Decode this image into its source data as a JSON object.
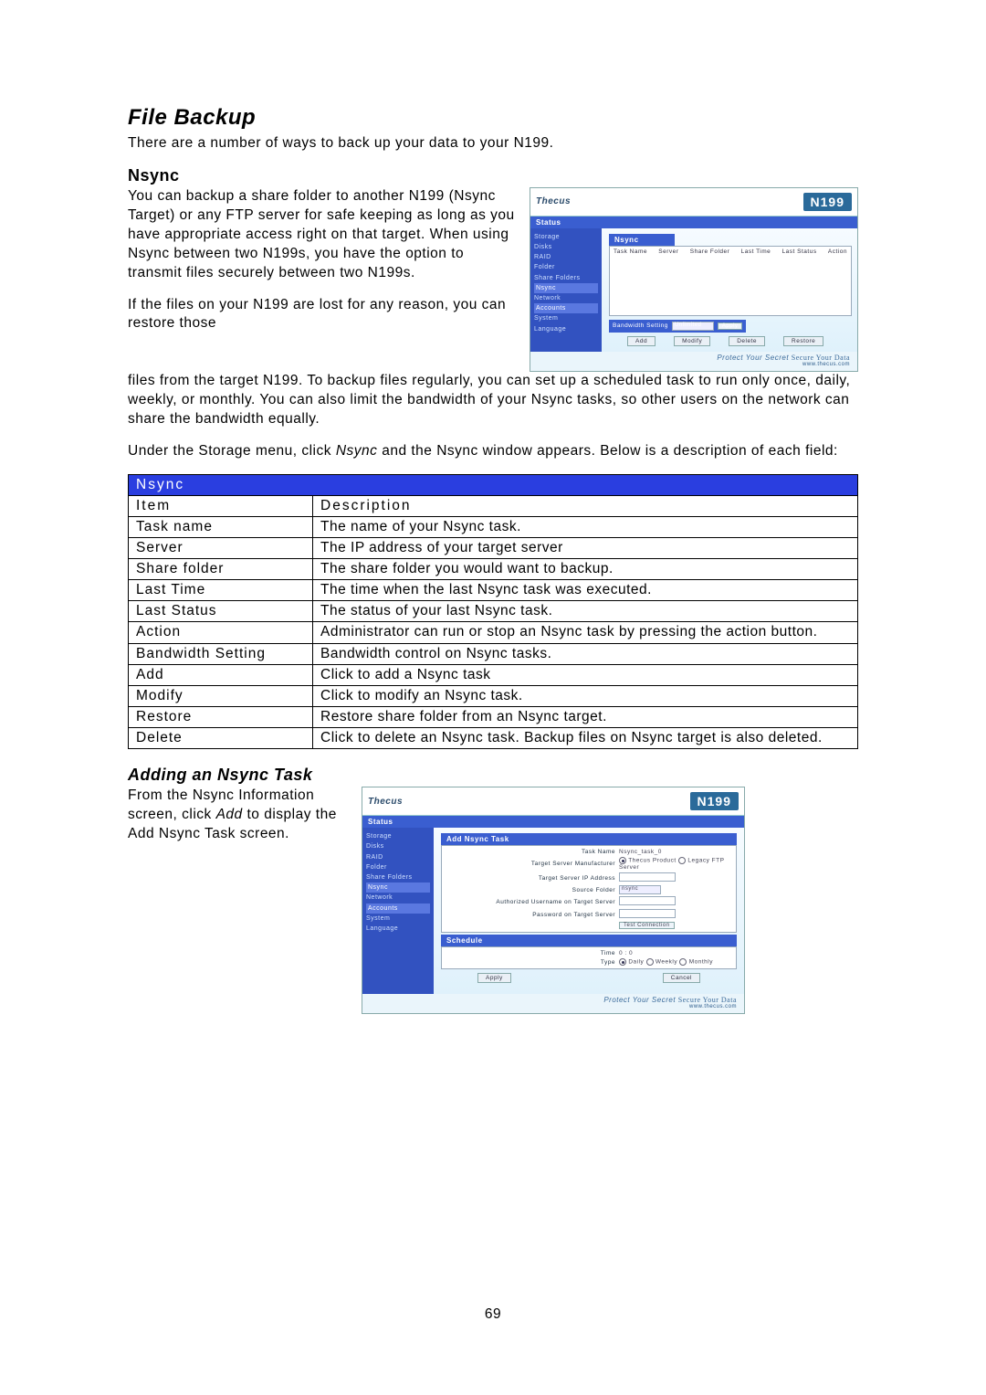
{
  "page_number": "69",
  "h_file_backup": "File Backup",
  "p_file_backup_intro": "There are a number of ways to back up your data to your N199.",
  "h_nsync": "Nsync",
  "nsync_p1": "You can backup a share folder to another N199 (Nsync Target) or any FTP server for safe keeping as long as you have appropriate access right on that target. When using Nsync between two N199s, you have the option to transmit files securely between two N199s.",
  "nsync_p2_a": "If the files on your N199 are lost for any reason, you can restore those",
  "nsync_p2_b": "files from the target N199. To backup files regularly, you can set up a scheduled task to run only once, daily, weekly, or monthly. You can also limit the bandwidth of your Nsync tasks, so other users on the network can share the bandwidth equally.",
  "nsync_p3_pre": "Under the Storage menu, click ",
  "nsync_p3_em": "Nsync",
  "nsync_p3_post": " and the Nsync window appears. Below is a description of each field:",
  "table": {
    "title": "Nsync",
    "head_item": "Item",
    "head_desc": "Description",
    "rows": [
      {
        "item": "Task name",
        "desc": "The name of your Nsync task."
      },
      {
        "item": "Server",
        "desc": "The IP address of your target server"
      },
      {
        "item": "Share folder",
        "desc": "The share folder you would want to backup."
      },
      {
        "item": "Last Time",
        "desc": "The time when the last Nsync task was executed."
      },
      {
        "item": "Last Status",
        "desc": "The status of your last Nsync task."
      },
      {
        "item": "Action",
        "desc": "Administrator can run or stop an Nsync task by pressing the action button."
      },
      {
        "item": "Bandwidth Setting",
        "desc": "Bandwidth control on Nsync tasks."
      },
      {
        "item": "Add",
        "desc": "Click to add a Nsync task"
      },
      {
        "item": "Modify",
        "desc": "Click to modify an Nsync task."
      },
      {
        "item": "Restore",
        "desc": "Restore share folder from an Nsync target."
      },
      {
        "item": "Delete",
        "desc": "Click to delete an Nsync task. Backup files on Nsync target is also deleted."
      }
    ]
  },
  "h_add_task": "Adding an Nsync Task",
  "add_p_pre": "From the Nsync Information screen, click ",
  "add_p_em": "Add",
  "add_p_post": " to display the Add Nsync Task screen.",
  "ss1": {
    "logo": "Thecus",
    "brand": "N199",
    "menubar": "Status",
    "sidebar": [
      "Storage",
      "  Disks",
      "  RAID",
      "  Folder",
      "  Share Folders",
      "  Nsync",
      "Network",
      "Accounts",
      "System",
      "Language"
    ],
    "panel_title": "Nsync",
    "cols": [
      "Task Name",
      "Server",
      "Share Folder",
      "Last Time",
      "Last Status",
      "Action"
    ],
    "bw_label": "Bandwidth Setting",
    "bw_value": "Unlimited",
    "bw_btn": "Apply",
    "buttons": [
      "Add",
      "Modify",
      "Delete",
      "Restore"
    ],
    "footer1": "Protect Your Secret",
    "footer2": "Secure Your Data",
    "footer_url": "www.thecus.com"
  },
  "ss2": {
    "logo": "Thecus",
    "brand": "N199",
    "menubar": "Status",
    "sidebar": [
      "Storage",
      "  Disks",
      "  RAID",
      "  Folder",
      "  Share Folders",
      "  Nsync",
      "Network",
      "Accounts",
      "System",
      "Language"
    ],
    "panel1": "Add Nsync Task",
    "f_taskname_l": "Task Name",
    "f_taskname_v": "Nsync_task_0",
    "f_mfg_l": "Target Server Manufacturer",
    "f_mfg_a": "Thecus Product",
    "f_mfg_b": "Legacy FTP Server",
    "f_ip_l": "Target Server IP Address",
    "f_src_l": "Source Folder",
    "f_src_v": "nsync",
    "f_auth_l": "Authorized Username on Target Server",
    "f_pwd_l": "Password on Target Server",
    "f_test_btn": "Test Connection",
    "panel2": "Schedule",
    "f_time_l": "Time",
    "f_time_v": "0 : 0",
    "f_type_l": "Type",
    "f_type_opts": [
      "Daily",
      "Weekly",
      "Monthly"
    ],
    "btn_apply": "Apply",
    "btn_cancel": "Cancel",
    "footer1": "Protect Your Secret",
    "footer2": "Secure Your Data",
    "footer_url": "www.thecus.com"
  }
}
